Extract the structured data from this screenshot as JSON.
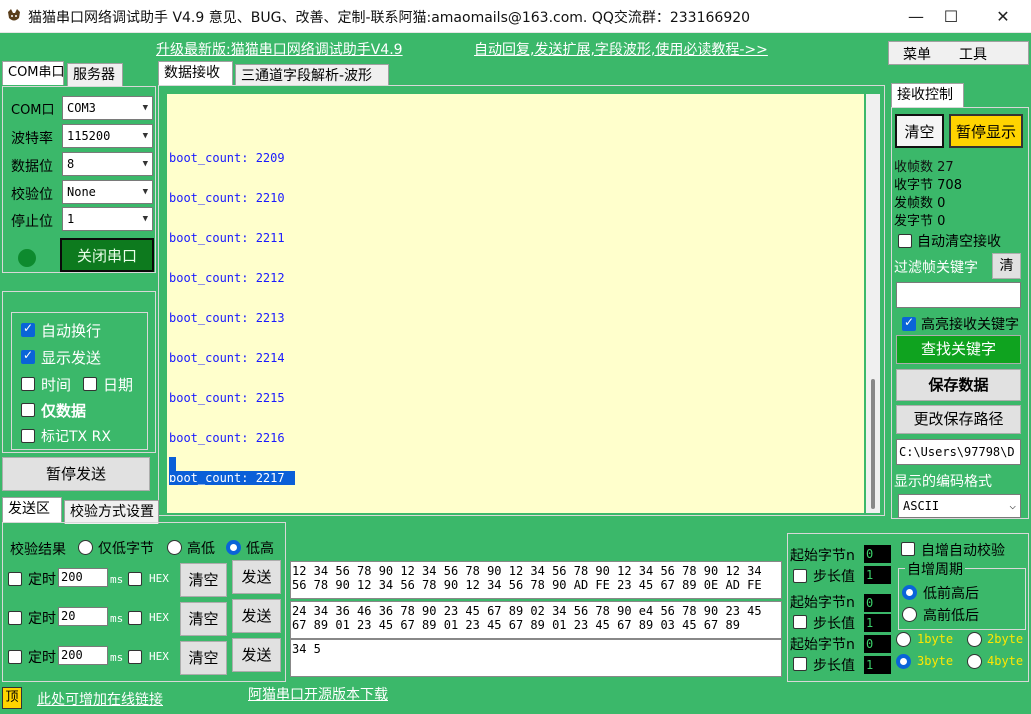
{
  "window": {
    "title": "猫猫串口网络调试助手 V4.9 意见、BUG、改善、定制-联系阿猫:amaomails@163.com. QQ交流群：233166920",
    "min": "—",
    "max": "☐",
    "close": "✕"
  },
  "top_links": {
    "upgrade": "升级最新版:猫猫串口网络调试助手V4.9",
    "tutorial": "自动回复,发送扩展,字段波形,使用必读教程->>"
  },
  "menu": {
    "menu": "菜单",
    "tools": "工具"
  },
  "left_tabs": {
    "com": "COM串口",
    "server": "服务器"
  },
  "serial": {
    "port_label": "COM口",
    "port_value": "COM3",
    "baud_label": "波特率",
    "baud_value": "115200",
    "data_label": "数据位",
    "data_value": "8",
    "parity_label": "校验位",
    "parity_value": "None",
    "stop_label": "停止位",
    "stop_value": "1",
    "close_button": "关闭串口"
  },
  "options": {
    "auto_wrap": "自动换行",
    "show_send": "显示发送",
    "time": "时间",
    "date": "日期",
    "data_only": "仅数据",
    "mark_txrx": "标记TX RX",
    "pause_send": "暂停发送"
  },
  "center_tabs": {
    "recv": "数据接收",
    "triple": "三通道字段解析-波形"
  },
  "recv_lines": [
    "boot_count: 2209",
    "boot_count: 2210",
    "boot_count: 2211",
    "boot_count: 2212",
    "boot_count: 2213",
    "boot_count: 2214",
    "boot_count: 2215",
    "boot_count: 2216",
    "boot_count: 2217"
  ],
  "right": {
    "tab": "接收控制",
    "clear": "清空",
    "pause_display": "暂停显示",
    "recv_frames_label": "收帧数",
    "recv_frames": "27",
    "recv_bytes_label": "收字节",
    "recv_bytes": "708",
    "send_frames_label": "发帧数",
    "send_frames": "0",
    "send_bytes_label": "发字节",
    "send_bytes": "0",
    "auto_clear": "自动清空接收",
    "filter_label": "过滤帧关键字",
    "filter_clear": "清",
    "highlight": "高亮接收关键字",
    "find_keyword": "查找关键字",
    "save_data": "保存数据",
    "change_path": "更改保存路径",
    "path": "C:\\Users\\97798\\D",
    "encoding_label": "显示的编码格式",
    "encoding_value": "ASCII"
  },
  "send_tabs": {
    "send_area": "发送区",
    "checksum": "校验方式设置"
  },
  "send": {
    "result_label": "校验结果",
    "low_only": "仅低字节",
    "high_low": "高低",
    "low_high": "低高",
    "rows": [
      {
        "timed": "定时",
        "interval": "200",
        "ms": "ms",
        "hex": "HEX",
        "clear": "清空",
        "send": "发送",
        "data": "12 34 56 78 90 12 34 56 78 90 12 34 56 78 90 12 34 56 78 90 12 34\n56 78 90 12 34 56 78 90 12 34 56 78 90 AD FE 23 45 67 89 0E AD FE"
      },
      {
        "timed": "定时",
        "interval": "20",
        "ms": "ms",
        "hex": "HEX",
        "clear": "清空",
        "send": "发送",
        "data": "24 34 36 46 36 78 90 23 45 67 89 02 34 56 78 90 e4 56 78 90 23 45\n67 89 01 23 45 67 89 01 23 45 67 89 01 23 45 67 89 03 45 67 89"
      },
      {
        "timed": "定时",
        "interval": "200",
        "ms": "ms",
        "hex": "HEX",
        "clear": "清空",
        "send": "发送",
        "data": "34 5"
      }
    ]
  },
  "checksum_panel": {
    "start_byte_label": "起始字节n",
    "step_label": "步长值",
    "start1": "0",
    "step1": "1",
    "start2": "0",
    "step2": "1",
    "start3": "0",
    "step3": "1",
    "auto_inc": "自增自动校验",
    "group_label": "自增周期",
    "high_first": "低前高后",
    "low_first": "高前低后",
    "b1": "1byte",
    "b2": "2byte",
    "b3": "3byte",
    "b4": "4byte"
  },
  "footer": {
    "pin": "顶",
    "add_link": "此处可增加在线链接",
    "download": "阿猫串口开源版本下载"
  }
}
